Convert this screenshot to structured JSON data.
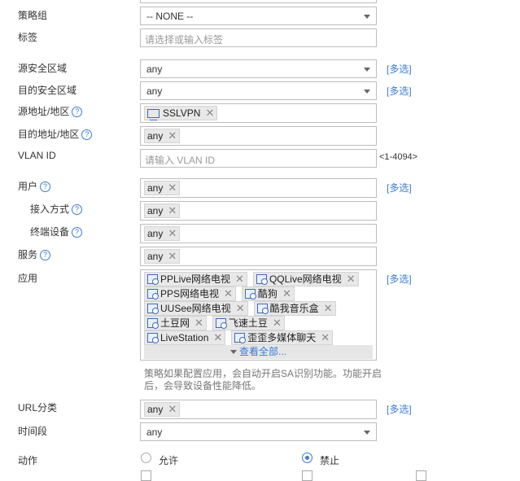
{
  "form": {
    "policy_group": {
      "label": "策略组",
      "value": "-- NONE --"
    },
    "tags": {
      "label": "标签",
      "placeholder": "请选择或输入标签"
    },
    "src_zone": {
      "label": "源安全区域",
      "value": "any",
      "multi": "[多选]"
    },
    "dst_zone": {
      "label": "目的安全区域",
      "value": "any",
      "multi": "[多选]"
    },
    "src_addr": {
      "label": "源地址/地区",
      "tags": [
        "SSLVPN"
      ]
    },
    "dst_addr": {
      "label": "目的地址/地区",
      "tags": [
        "any"
      ]
    },
    "vlan": {
      "label": "VLAN ID",
      "placeholder": "请输入 VLAN ID",
      "range": "<1-4094>"
    },
    "user": {
      "label": "用户",
      "tags": [
        "any"
      ],
      "multi": "[多选]"
    },
    "access": {
      "label": "接入方式",
      "tags": [
        "any"
      ]
    },
    "terminal": {
      "label": "终端设备",
      "tags": [
        "any"
      ]
    },
    "service": {
      "label": "服务",
      "tags": [
        "any"
      ]
    },
    "app": {
      "label": "应用",
      "multi": "[多选]",
      "tags": [
        "PPLive网络电视",
        "QQLive网络电视",
        "PPS网络电视",
        "酷狗",
        "UUSee网络电视",
        "酷我音乐盒",
        "土豆网",
        "飞速土豆",
        "LiveStation",
        "歪歪多媒体聊天"
      ],
      "view_all": "查看全部...",
      "hint": "策略如果配置应用，会自动开启SA识别功能。功能开启后，会导致设备性能降低。"
    },
    "url": {
      "label": "URL分类",
      "tags": [
        "any"
      ],
      "multi": "[多选]"
    },
    "time": {
      "label": "时间段",
      "value": "any"
    },
    "action": {
      "label": "动作",
      "options": [
        "允许",
        "禁止"
      ],
      "selected": "禁止"
    }
  },
  "colors": {
    "accent": "#3a7ad5",
    "tag_bg": "#e8e8e8",
    "border": "#bdbdbd"
  }
}
